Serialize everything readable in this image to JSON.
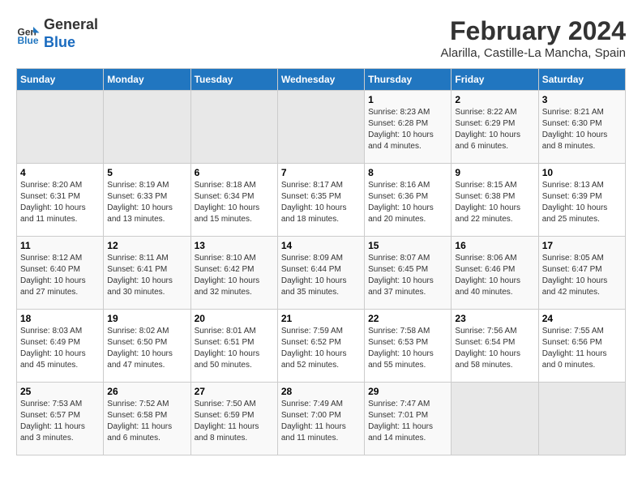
{
  "logo": {
    "line1": "General",
    "line2": "Blue"
  },
  "title": "February 2024",
  "subtitle": "Alarilla, Castille-La Mancha, Spain",
  "headers": [
    "Sunday",
    "Monday",
    "Tuesday",
    "Wednesday",
    "Thursday",
    "Friday",
    "Saturday"
  ],
  "weeks": [
    [
      {
        "day": "",
        "info": ""
      },
      {
        "day": "",
        "info": ""
      },
      {
        "day": "",
        "info": ""
      },
      {
        "day": "",
        "info": ""
      },
      {
        "day": "1",
        "info": "Sunrise: 8:23 AM\nSunset: 6:28 PM\nDaylight: 10 hours\nand 4 minutes."
      },
      {
        "day": "2",
        "info": "Sunrise: 8:22 AM\nSunset: 6:29 PM\nDaylight: 10 hours\nand 6 minutes."
      },
      {
        "day": "3",
        "info": "Sunrise: 8:21 AM\nSunset: 6:30 PM\nDaylight: 10 hours\nand 8 minutes."
      }
    ],
    [
      {
        "day": "4",
        "info": "Sunrise: 8:20 AM\nSunset: 6:31 PM\nDaylight: 10 hours\nand 11 minutes."
      },
      {
        "day": "5",
        "info": "Sunrise: 8:19 AM\nSunset: 6:33 PM\nDaylight: 10 hours\nand 13 minutes."
      },
      {
        "day": "6",
        "info": "Sunrise: 8:18 AM\nSunset: 6:34 PM\nDaylight: 10 hours\nand 15 minutes."
      },
      {
        "day": "7",
        "info": "Sunrise: 8:17 AM\nSunset: 6:35 PM\nDaylight: 10 hours\nand 18 minutes."
      },
      {
        "day": "8",
        "info": "Sunrise: 8:16 AM\nSunset: 6:36 PM\nDaylight: 10 hours\nand 20 minutes."
      },
      {
        "day": "9",
        "info": "Sunrise: 8:15 AM\nSunset: 6:38 PM\nDaylight: 10 hours\nand 22 minutes."
      },
      {
        "day": "10",
        "info": "Sunrise: 8:13 AM\nSunset: 6:39 PM\nDaylight: 10 hours\nand 25 minutes."
      }
    ],
    [
      {
        "day": "11",
        "info": "Sunrise: 8:12 AM\nSunset: 6:40 PM\nDaylight: 10 hours\nand 27 minutes."
      },
      {
        "day": "12",
        "info": "Sunrise: 8:11 AM\nSunset: 6:41 PM\nDaylight: 10 hours\nand 30 minutes."
      },
      {
        "day": "13",
        "info": "Sunrise: 8:10 AM\nSunset: 6:42 PM\nDaylight: 10 hours\nand 32 minutes."
      },
      {
        "day": "14",
        "info": "Sunrise: 8:09 AM\nSunset: 6:44 PM\nDaylight: 10 hours\nand 35 minutes."
      },
      {
        "day": "15",
        "info": "Sunrise: 8:07 AM\nSunset: 6:45 PM\nDaylight: 10 hours\nand 37 minutes."
      },
      {
        "day": "16",
        "info": "Sunrise: 8:06 AM\nSunset: 6:46 PM\nDaylight: 10 hours\nand 40 minutes."
      },
      {
        "day": "17",
        "info": "Sunrise: 8:05 AM\nSunset: 6:47 PM\nDaylight: 10 hours\nand 42 minutes."
      }
    ],
    [
      {
        "day": "18",
        "info": "Sunrise: 8:03 AM\nSunset: 6:49 PM\nDaylight: 10 hours\nand 45 minutes."
      },
      {
        "day": "19",
        "info": "Sunrise: 8:02 AM\nSunset: 6:50 PM\nDaylight: 10 hours\nand 47 minutes."
      },
      {
        "day": "20",
        "info": "Sunrise: 8:01 AM\nSunset: 6:51 PM\nDaylight: 10 hours\nand 50 minutes."
      },
      {
        "day": "21",
        "info": "Sunrise: 7:59 AM\nSunset: 6:52 PM\nDaylight: 10 hours\nand 52 minutes."
      },
      {
        "day": "22",
        "info": "Sunrise: 7:58 AM\nSunset: 6:53 PM\nDaylight: 10 hours\nand 55 minutes."
      },
      {
        "day": "23",
        "info": "Sunrise: 7:56 AM\nSunset: 6:54 PM\nDaylight: 10 hours\nand 58 minutes."
      },
      {
        "day": "24",
        "info": "Sunrise: 7:55 AM\nSunset: 6:56 PM\nDaylight: 11 hours\nand 0 minutes."
      }
    ],
    [
      {
        "day": "25",
        "info": "Sunrise: 7:53 AM\nSunset: 6:57 PM\nDaylight: 11 hours\nand 3 minutes."
      },
      {
        "day": "26",
        "info": "Sunrise: 7:52 AM\nSunset: 6:58 PM\nDaylight: 11 hours\nand 6 minutes."
      },
      {
        "day": "27",
        "info": "Sunrise: 7:50 AM\nSunset: 6:59 PM\nDaylight: 11 hours\nand 8 minutes."
      },
      {
        "day": "28",
        "info": "Sunrise: 7:49 AM\nSunset: 7:00 PM\nDaylight: 11 hours\nand 11 minutes."
      },
      {
        "day": "29",
        "info": "Sunrise: 7:47 AM\nSunset: 7:01 PM\nDaylight: 11 hours\nand 14 minutes."
      },
      {
        "day": "",
        "info": ""
      },
      {
        "day": "",
        "info": ""
      }
    ]
  ]
}
